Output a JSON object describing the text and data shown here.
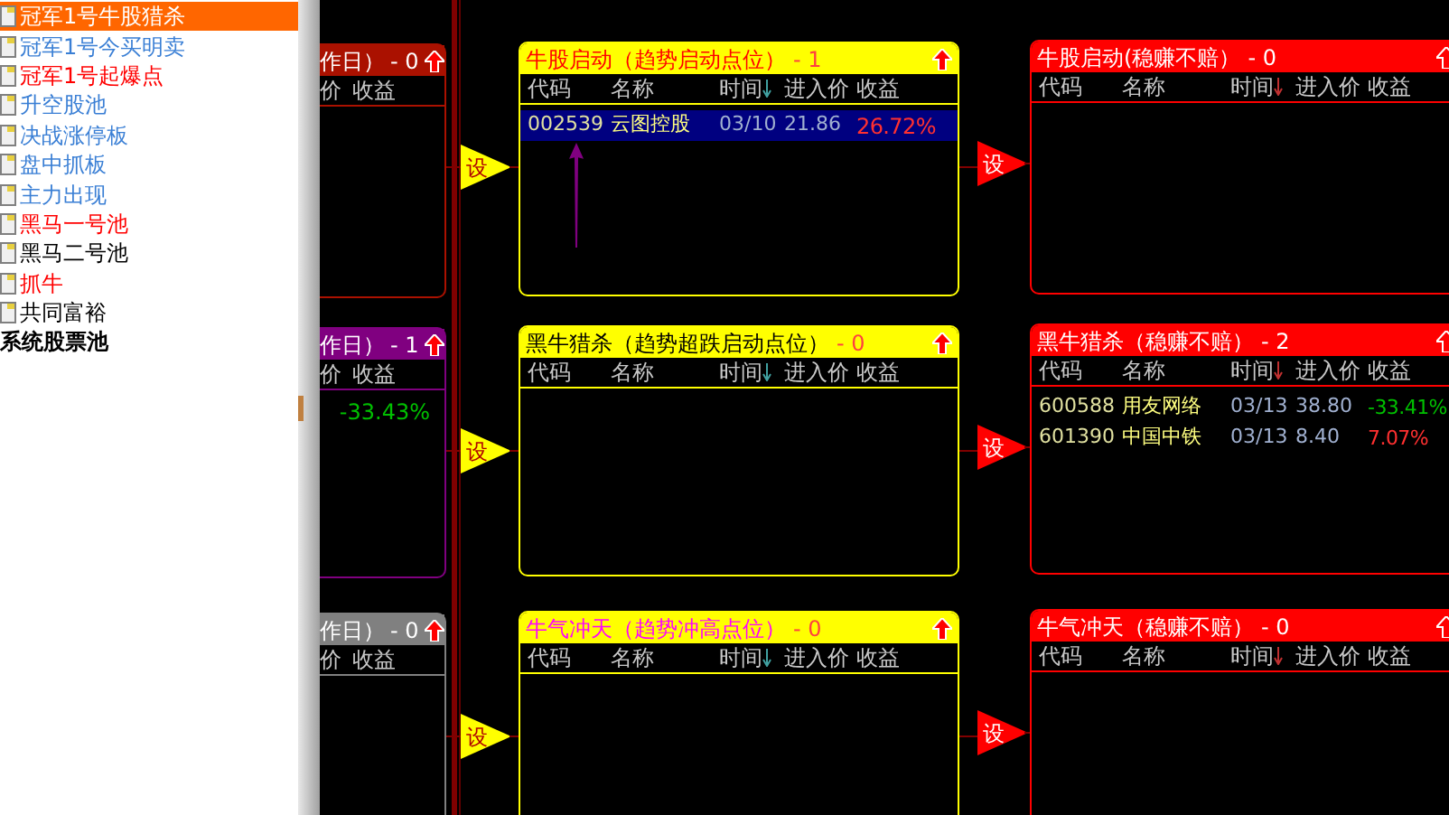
{
  "sidebar": {
    "items": [
      {
        "label": "冠军1号牛股猎杀",
        "color": "#ffffff",
        "selected": true
      },
      {
        "label": "冠军1号今买明卖",
        "color": "#3a7fd5",
        "selected": false
      },
      {
        "label": "冠军1号起爆点",
        "color": "#ff0000",
        "selected": false
      },
      {
        "label": "升空股池",
        "color": "#3a7fd5",
        "selected": false
      },
      {
        "label": "决战涨停板",
        "color": "#3a7fd5",
        "selected": false
      },
      {
        "label": "盘中抓板",
        "color": "#3a7fd5",
        "selected": false
      },
      {
        "label": "主力出现",
        "color": "#3a7fd5",
        "selected": false
      },
      {
        "label": "黑马一号池",
        "color": "#ff0000",
        "selected": false
      },
      {
        "label": "黑马二号池",
        "color": "#000000",
        "selected": false
      },
      {
        "label": "抓牛",
        "color": "#ff0000",
        "selected": false
      },
      {
        "label": "共同富裕",
        "color": "#000000",
        "selected": false
      }
    ],
    "footer": "系统股票池"
  },
  "stages": [
    {
      "left": {
        "title": "作日）",
        "count": "- 0",
        "color": "#aa1100",
        "columns": [
          "价",
          "收益"
        ]
      },
      "trigger": "设",
      "middle": {
        "title": "牛股启动（趋势启动点位）",
        "count": "- 1",
        "color": "#ff0000",
        "columns": [
          "代码",
          "名称",
          "时间",
          "进入价",
          "收益"
        ],
        "rows": [
          {
            "code": "002539",
            "name": "云图控股",
            "time": "03/10",
            "price": "21.86",
            "gain": "26.72%",
            "color": "#ff3030",
            "selected": true
          }
        ]
      },
      "trigger2": "设",
      "right": {
        "title": "牛股启动(稳赚不赔）",
        "count": "- 0",
        "columns": [
          "代码",
          "名称",
          "时间",
          "进入价",
          "收益"
        ]
      }
    },
    {
      "left": {
        "title": "作日）",
        "count": "- 1",
        "color": "#800080",
        "columns": [
          "价",
          "收益"
        ],
        "rows": [
          {
            "gain": "-33.43%",
            "color": "#00c000"
          }
        ]
      },
      "trigger": "设",
      "middle": {
        "title": "黑牛猎杀（趋势超跌启动点位）",
        "count": "- 0",
        "color": "#000000",
        "columns": [
          "代码",
          "名称",
          "时间",
          "进入价",
          "收益"
        ]
      },
      "trigger2": "设",
      "right": {
        "title": "黑牛猎杀（稳赚不赔）",
        "count": "- 2",
        "columns": [
          "代码",
          "名称",
          "时间",
          "进入价",
          "收益"
        ],
        "rows": [
          {
            "code": "600588",
            "name": "用友网络",
            "time": "03/13",
            "price": "38.80",
            "gain": "-33.41%",
            "color": "#00c000",
            "selected": false
          },
          {
            "code": "601390",
            "name": "中国中铁",
            "time": "03/13",
            "price": "8.40",
            "gain": "7.07%",
            "color": "#ff3030",
            "selected": false
          }
        ]
      }
    },
    {
      "left": {
        "title": "作日）",
        "count": "- 0",
        "color": "#808080",
        "columns": [
          "价",
          "收益"
        ]
      },
      "trigger": "设",
      "middle": {
        "title": "牛气冲天（趋势冲高点位）",
        "count": "- 0",
        "color": "#ff00ff",
        "columns": [
          "代码",
          "名称",
          "时间",
          "进入价",
          "收益"
        ]
      },
      "trigger2": "设",
      "right": {
        "title": "牛气冲天（稳赚不赔）",
        "count": "- 0",
        "columns": [
          "代码",
          "名称",
          "时间",
          "进入价",
          "收益"
        ]
      }
    }
  ]
}
